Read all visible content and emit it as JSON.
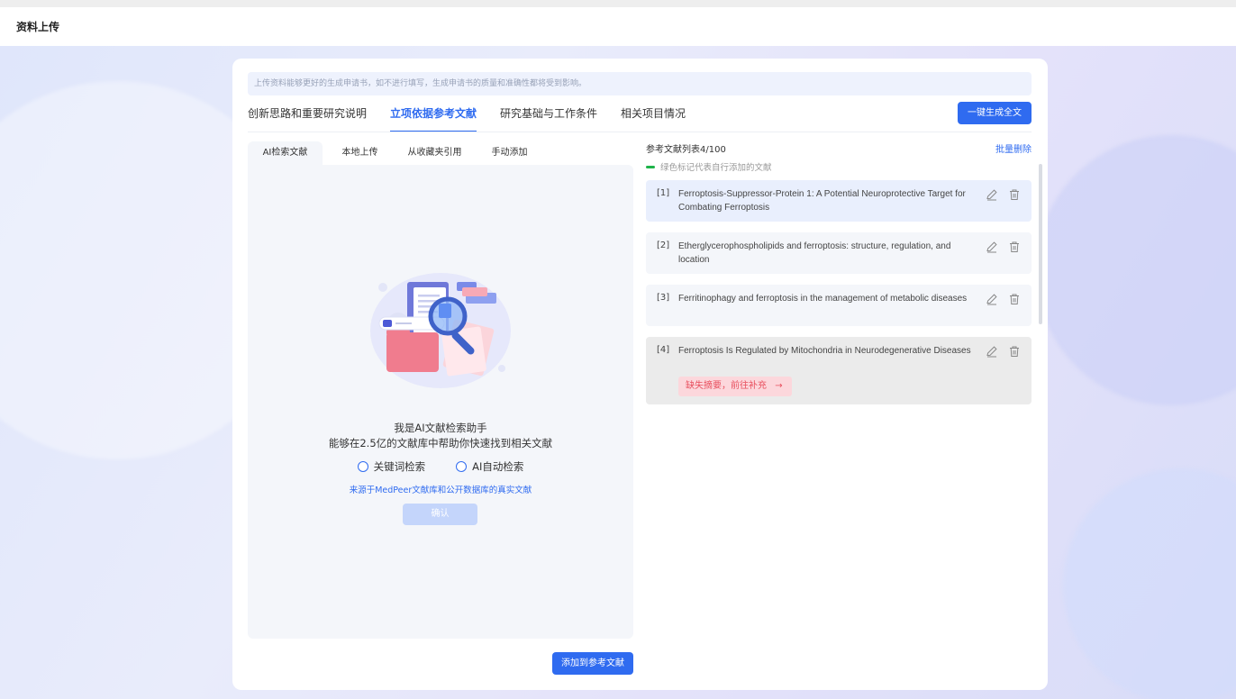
{
  "header": {
    "title": "资料上传"
  },
  "notice": "上传资料能够更好的生成申请书，如不进行填写，生成申请书的质量和准确性都将受到影响。",
  "main_tabs": [
    {
      "label": "创新思路和重要研究说明",
      "active": false
    },
    {
      "label": "立项依据参考文献",
      "active": true
    },
    {
      "label": "研究基础与工作条件",
      "active": false
    },
    {
      "label": "相关项目情况",
      "active": false
    }
  ],
  "generate_button": "一键生成全文",
  "sub_tabs": [
    {
      "label": "AI检索文献",
      "active": true
    },
    {
      "label": "本地上传",
      "active": false
    },
    {
      "label": "从收藏夹引用",
      "active": false
    },
    {
      "label": "手动添加",
      "active": false
    }
  ],
  "assistant": {
    "title": "我是AI文献检索助手",
    "description": "能够在2.5亿的文献库中帮助你快速找到相关文献",
    "options": [
      "关键词检索",
      "AI自动检索"
    ],
    "source_note": "来源于MedPeer文献库和公开数据库的真实文献",
    "confirm_label": "确认"
  },
  "add_button": "添加到参考文献",
  "references": {
    "header": "参考文献列表4/100",
    "batch_delete": "批量删除",
    "legend": "绿色标记代表自行添加的文献",
    "items": [
      {
        "num": "[1]",
        "title": "Ferroptosis-Suppressor-Protein 1: A Potential Neuroprotective Target for Combating Ferroptosis"
      },
      {
        "num": "[2]",
        "title": "Etherglycerophospholipids and ferroptosis: structure, regulation, and location"
      },
      {
        "num": "[3]",
        "title": "Ferritinophagy and ferroptosis in the management of metabolic diseases"
      },
      {
        "num": "[4]",
        "title": "Ferroptosis Is Regulated by Mitochondria in Neurodegenerative Diseases",
        "warning": "缺失摘要，前往补充"
      }
    ]
  },
  "colors": {
    "accent": "#2f6bf0",
    "legend_green": "#1eb34a",
    "warning_text": "#e8505f"
  }
}
